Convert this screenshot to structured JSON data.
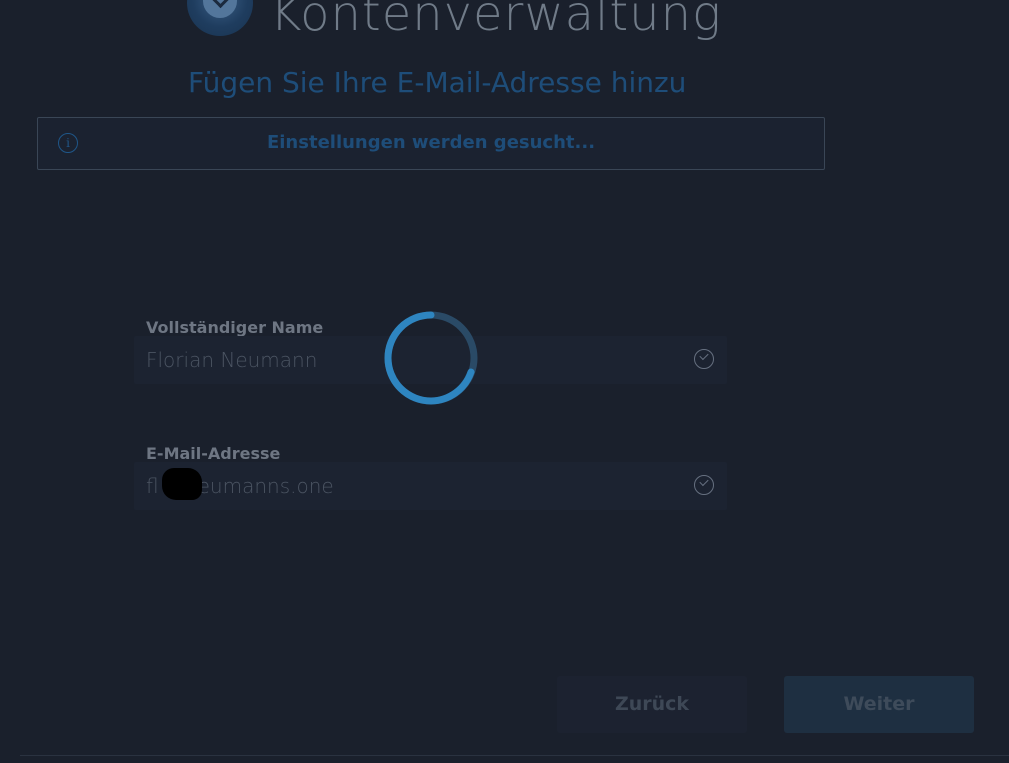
{
  "header": {
    "app_title": "Kontenverwaltung",
    "subtitle": "Fügen Sie Ihre E-Mail-Adresse hinzu"
  },
  "banner": {
    "icon": "info-icon",
    "icon_glyph": "i",
    "text": "Einstellungen werden gesucht..."
  },
  "form": {
    "full_name": {
      "label": "Vollständiger Name",
      "value": "Florian Neumann",
      "status_icon": "check-circle-icon"
    },
    "email": {
      "label": "E-Mail-Adresse",
      "value": "fl     @neumanns.one",
      "status_icon": "check-circle-icon"
    }
  },
  "spinner": {
    "icon": "loading-spinner-icon",
    "accent_color": "#2f8fd0",
    "track_color": "#2a4a66"
  },
  "buttons": {
    "back_label": "Zurück",
    "next_label": "Weiter"
  },
  "colors": {
    "background": "#1a202c",
    "accent": "#1e4d79"
  }
}
